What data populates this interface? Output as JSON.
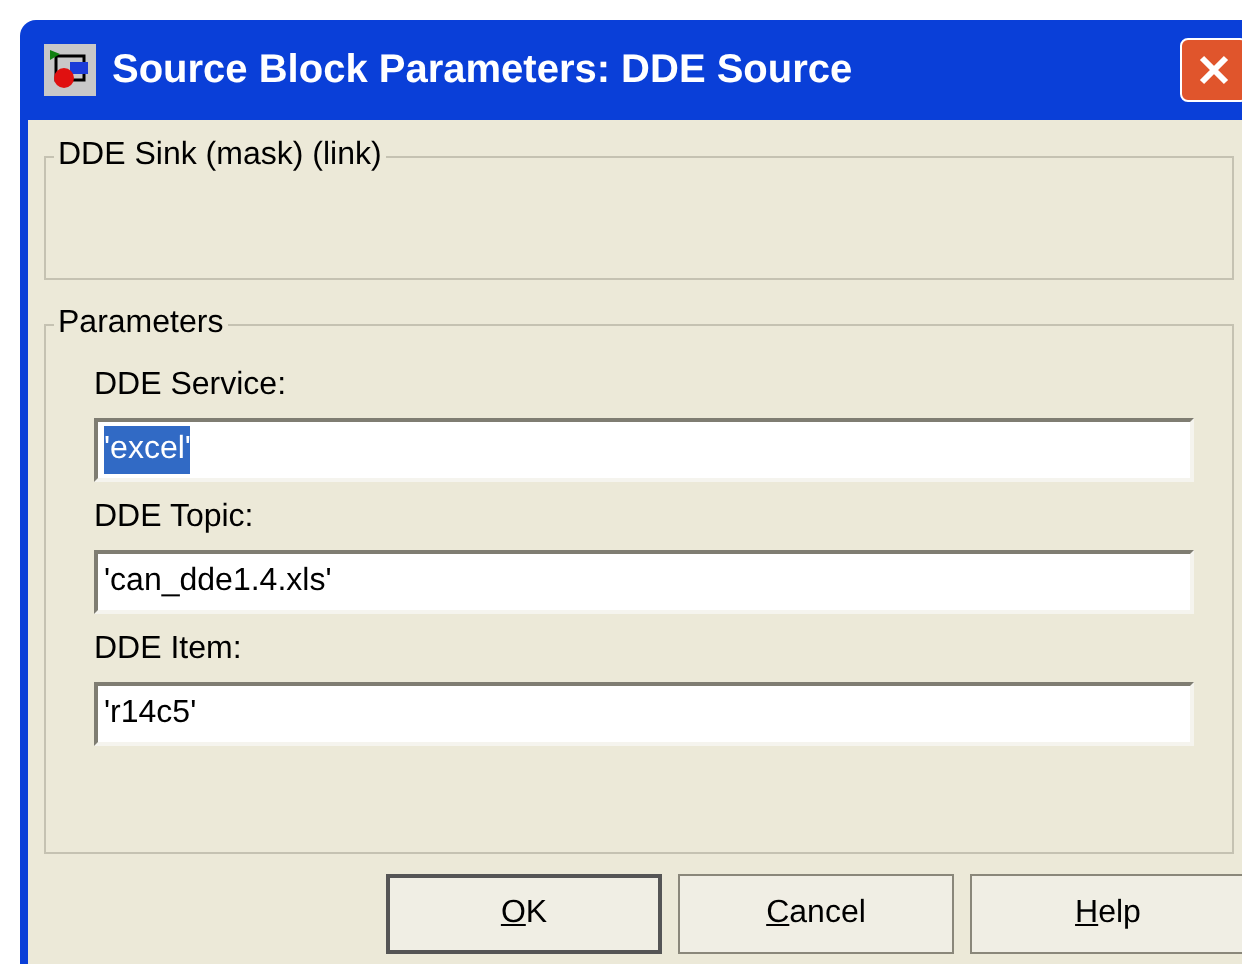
{
  "window": {
    "title": "Source Block Parameters: DDE Source"
  },
  "description_group": {
    "title": "DDE Sink (mask) (link)"
  },
  "parameters_group": {
    "title": "Parameters",
    "fields": [
      {
        "label": "DDE Service:",
        "value": "'excel'",
        "selected": true
      },
      {
        "label": "DDE Topic:",
        "value": "'can_dde1.4.xls'",
        "selected": false
      },
      {
        "label": "DDE Item:",
        "value": "'r14c5'",
        "selected": false
      }
    ]
  },
  "buttons": [
    {
      "mnemonic": "O",
      "rest": "K",
      "default": true
    },
    {
      "mnemonic": "C",
      "rest": "ancel",
      "default": false
    },
    {
      "mnemonic": "H",
      "rest": "elp",
      "default": false
    }
  ]
}
